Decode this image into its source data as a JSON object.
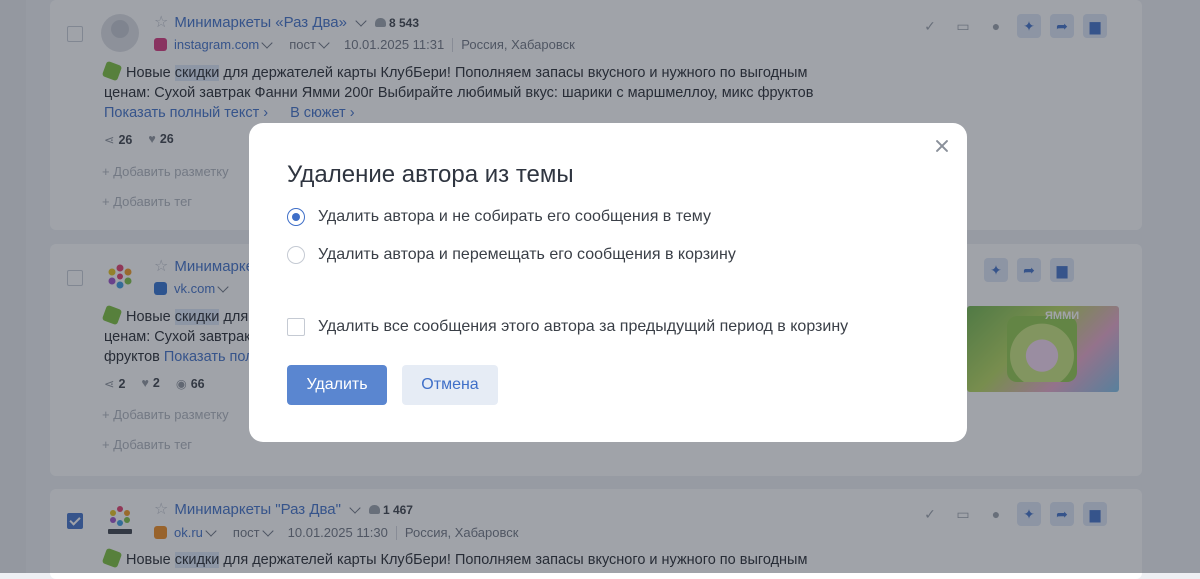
{
  "posts": [
    {
      "author": "Минимаркеты «Раз Два»",
      "subscribers": "8 543",
      "domain": "instagram.com",
      "type": "пост",
      "datetime": "10.01.2025 11:31",
      "location": "Россия, Хабаровск",
      "text_before": "Новые ",
      "text_hl": "скидки",
      "text_after": " для держателей карты КлубБери! Пополняем запасы вкусного и нужного по выгодным ценам: Сухой завтрак Фанни Ямми 200г Выбирайте любимый вкус: шарики с маршмеллоу, микс фруктов ",
      "show_full": "Показать полный текст ›",
      "to_story": "В сюжет ›",
      "reposts": "26",
      "likes": "26",
      "add_markup": "+ Добавить разметку",
      "add_tag": "+ Добавить тег",
      "social_color": "#d6337a"
    },
    {
      "author": "Минимаркеты",
      "domain": "vk.com",
      "text_before": "Новые ",
      "text_hl": "скидки",
      "text_after_1": " для",
      "line2": "ценам: Сухой завтрак",
      "line3": "фруктов ",
      "show_full": "Показать пол",
      "reposts": "2",
      "likes": "2",
      "views": "66",
      "add_markup": "+ Добавить разметку",
      "add_tag": "+ Добавить тег",
      "social_color": "#2f6fd0"
    },
    {
      "author": "Минимаркеты \"Раз Два\"",
      "subscribers": "1 467",
      "domain": "ok.ru",
      "type": "пост",
      "datetime": "10.01.2025 11:30",
      "location": "Россия, Хабаровск",
      "text_before": "Новые ",
      "text_hl": "скидки",
      "text_after": " для держателей карты КлубБери! Пополняем запасы вкусного и нужного по выгодным",
      "social_color": "#f08a1c"
    }
  ],
  "thumb_text": "ЯММИ",
  "modal": {
    "title": "Удаление автора из темы",
    "option_1": "Удалить автора и не собирать его сообщения в тему",
    "option_2": "Удалить автора и перемещать его сообщения в корзину",
    "checkbox": "Удалить все сообщения этого автора за предыдущий период в корзину",
    "confirm": "Удалить",
    "cancel": "Отмена",
    "selected_option": 1,
    "checkbox_checked": false
  },
  "colors": {
    "accent": "#3f6fc8",
    "primary_button": "#5a86d0",
    "overlay": "rgba(45,52,65,0.45)"
  }
}
